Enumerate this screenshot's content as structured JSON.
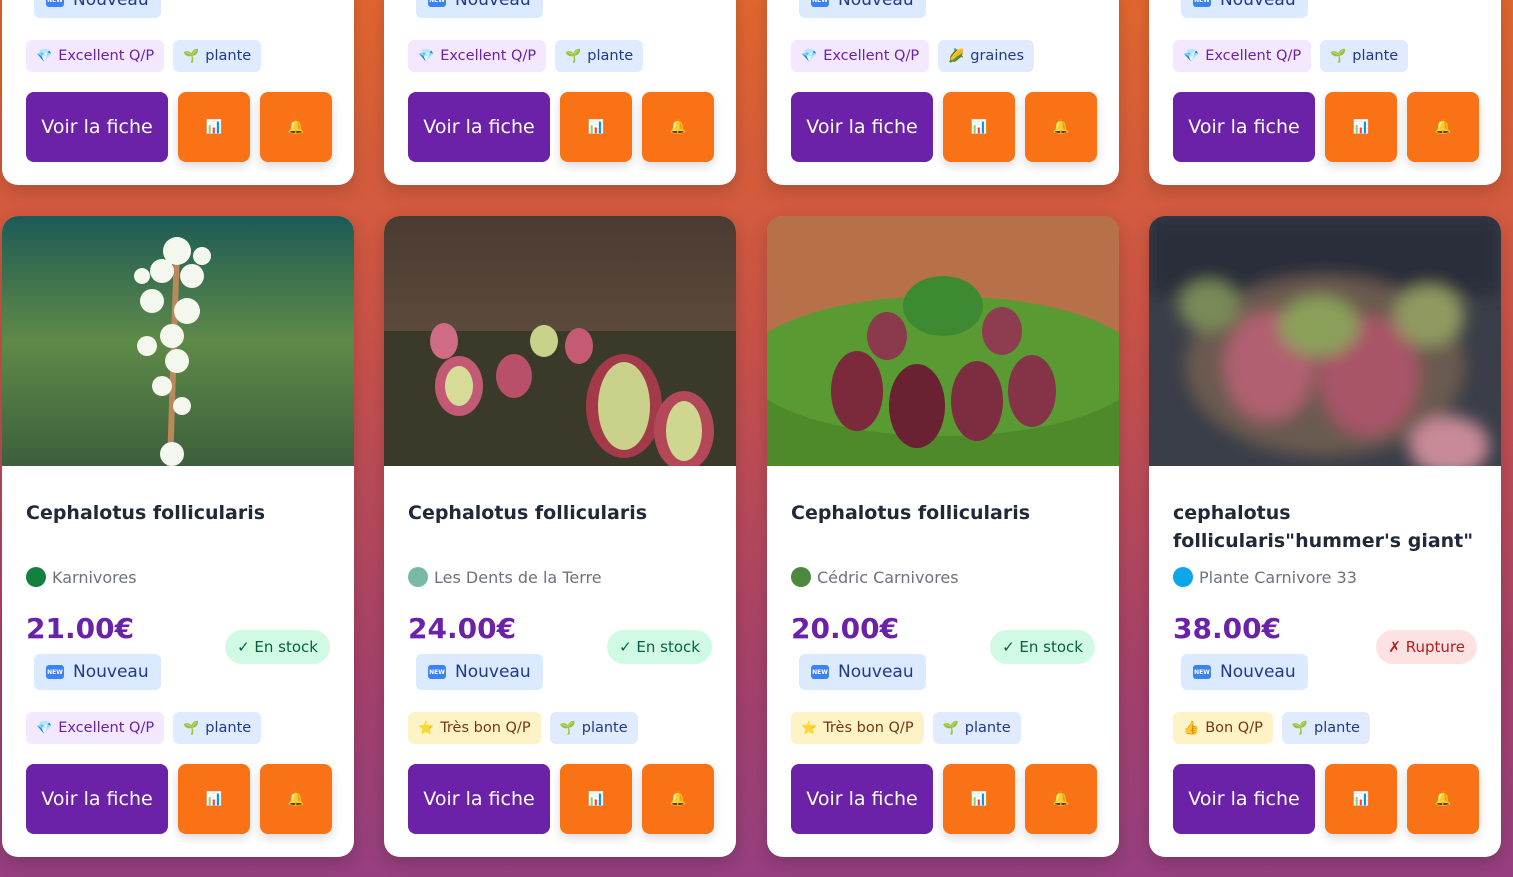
{
  "common": {
    "new_badge": "Nouveau",
    "new_icon_text": "NEW",
    "view_button": "Voir la fiche",
    "stats_icon": "bar-chart-icon",
    "alert_icon": "bell-icon",
    "in_stock": "✓ En stock",
    "out_of_stock": "✗ Rupture"
  },
  "top_cards": [
    {
      "qp": "Excellent Q/P",
      "kind": "plante"
    },
    {
      "qp": "Excellent Q/P",
      "kind": "plante"
    },
    {
      "qp": "Excellent Q/P",
      "kind": "graines"
    },
    {
      "qp": "Excellent Q/P",
      "kind": "plante"
    }
  ],
  "products": [
    {
      "title": "Cephalotus follicularis",
      "seller": "Karnivores",
      "seller_color": "#15803d",
      "price": "21.00€",
      "stock": "✓ En stock",
      "qp": "Excellent Q/P",
      "kind": "plante"
    },
    {
      "title": "Cephalotus follicularis",
      "seller": "Les Dents de la Terre",
      "seller_color": "#7ab8a8",
      "price": "24.00€",
      "stock": "✓ En stock",
      "qp": "Très bon Q/P",
      "kind": "plante"
    },
    {
      "title": "Cephalotus follicularis",
      "seller": "Cédric Carnivores",
      "seller_color": "#4b8a3c",
      "price": "20.00€",
      "stock": "✓ En stock",
      "qp": "Très bon Q/P",
      "kind": "plante"
    },
    {
      "title": "cephalotus follicularis\"hummer's giant\"",
      "seller": "Plante Carnivore 33",
      "seller_color": "#0ea5e9",
      "price": "38.00€",
      "stock": "✗ Rupture",
      "qp": "Bon Q/P",
      "kind": "plante"
    }
  ],
  "colors": {
    "brand_purple": "#6b21a8",
    "accent_orange": "#f97316"
  }
}
